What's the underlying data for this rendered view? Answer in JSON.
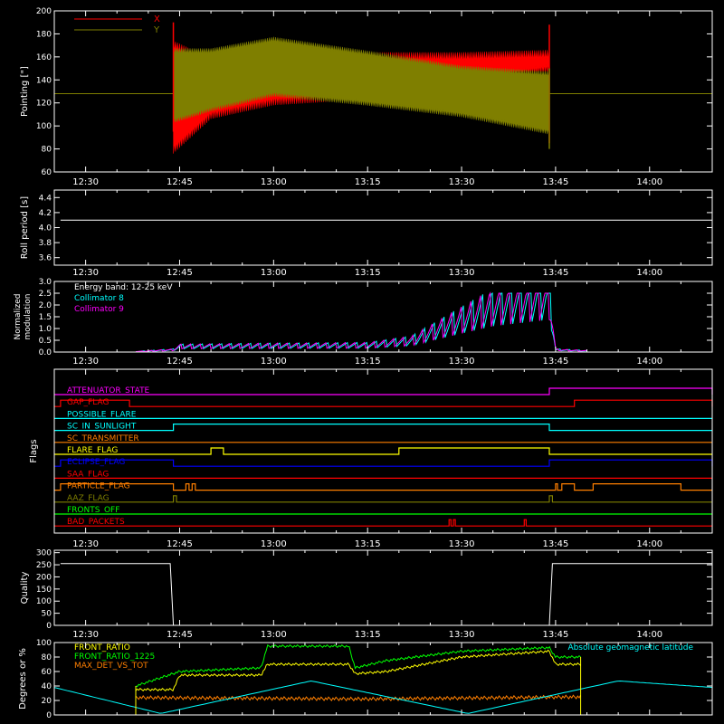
{
  "time_ticks": [
    "12:30",
    "12:45",
    "13:00",
    "13:15",
    "13:30",
    "13:45",
    "14:00"
  ],
  "time_range": [
    "12:25",
    "14:10"
  ],
  "colors": {
    "background": "#000000",
    "axes": "#ffffff",
    "red": "#ff0000",
    "olive": "#7f7f00",
    "cyan": "#00ffff",
    "magenta": "#ff00ff",
    "yellow": "#ffff00",
    "green": "#00ff00",
    "orange": "#ff7f00",
    "blue": "#0000ff",
    "white": "#ffffff"
  },
  "chart_data": [
    {
      "id": "pointing",
      "type": "line",
      "ylabel": "Pointing [\"]",
      "ylim": [
        60,
        200
      ],
      "yticks": [
        60,
        80,
        100,
        120,
        140,
        160,
        180,
        200
      ],
      "legend_position": "top-left",
      "series": [
        {
          "name": "X",
          "color": "#ff0000",
          "baseline": 128,
          "upper": [
            {
              "x": "12:44",
              "y": 170
            },
            {
              "x": "12:50",
              "y": 155
            },
            {
              "x": "13:00",
              "y": 155
            },
            {
              "x": "13:15",
              "y": 160
            },
            {
              "x": "13:30",
              "y": 160
            },
            {
              "x": "13:44",
              "y": 162
            }
          ],
          "lower": [
            {
              "x": "12:44",
              "y": 80
            },
            {
              "x": "12:50",
              "y": 110
            },
            {
              "x": "13:00",
              "y": 122
            },
            {
              "x": "13:15",
              "y": 127
            },
            {
              "x": "13:30",
              "y": 140
            },
            {
              "x": "13:44",
              "y": 150
            }
          ]
        },
        {
          "name": "Y",
          "color": "#7f7f00",
          "baseline": 128,
          "upper": [
            {
              "x": "12:44",
              "y": 165
            },
            {
              "x": "12:50",
              "y": 165
            },
            {
              "x": "13:00",
              "y": 175
            },
            {
              "x": "13:15",
              "y": 163
            },
            {
              "x": "13:30",
              "y": 150
            },
            {
              "x": "13:44",
              "y": 145
            }
          ],
          "lower": [
            {
              "x": "12:44",
              "y": 105
            },
            {
              "x": "12:50",
              "y": 115
            },
            {
              "x": "13:00",
              "y": 128
            },
            {
              "x": "13:15",
              "y": 120
            },
            {
              "x": "13:30",
              "y": 110
            },
            {
              "x": "13:44",
              "y": 95
            }
          ]
        }
      ]
    },
    {
      "id": "roll",
      "type": "line",
      "ylabel": "Roll period [s]",
      "ylim": [
        3.5,
        4.5
      ],
      "yticks": [
        3.6,
        3.8,
        4.0,
        4.2,
        4.4
      ],
      "series": [
        {
          "name": "",
          "color": "#ffffff",
          "points": [
            {
              "x": "12:26",
              "y": 4.1
            },
            {
              "x": "14:10",
              "y": 4.1
            }
          ]
        }
      ]
    },
    {
      "id": "modulation",
      "type": "line",
      "ylabel": "Normalized modulation",
      "ylabel_lines": [
        "Normalized",
        "modulation"
      ],
      "ylim": [
        0,
        3
      ],
      "yticks": [
        0.0,
        0.5,
        1.0,
        1.5,
        2.0,
        2.5,
        3.0
      ],
      "annotation": "Energy band: 12-25 keV",
      "series": [
        {
          "name": "Collimator 8",
          "color": "#00ffff"
        },
        {
          "name": "Collimator 9",
          "color": "#ff00ff"
        }
      ],
      "envelope": [
        {
          "x": "12:38",
          "y": 0.02
        },
        {
          "x": "12:44",
          "y": 0.1
        },
        {
          "x": "12:45",
          "y": 0.25
        },
        {
          "x": "13:00",
          "y": 0.28
        },
        {
          "x": "13:15",
          "y": 0.3
        },
        {
          "x": "13:22",
          "y": 0.5
        },
        {
          "x": "13:28",
          "y": 1.2
        },
        {
          "x": "13:35",
          "y": 2.0
        },
        {
          "x": "13:44",
          "y": 2.5
        },
        {
          "x": "13:45",
          "y": 0.1
        },
        {
          "x": "13:50",
          "y": 0.05
        }
      ]
    },
    {
      "id": "flags",
      "type": "line",
      "ylabel": "Flags",
      "rows": [
        {
          "label": "ATTENUATOR_STATE",
          "color": "#ff00ff",
          "highs": [
            [
              "13:44",
              "14:10"
            ]
          ]
        },
        {
          "label": "GAP_FLAG",
          "color": "#ff0000",
          "highs": [
            [
              "12:26",
              "12:37"
            ],
            [
              "13:48",
              "14:10"
            ]
          ]
        },
        {
          "label": "POSSIBLE_FLARE",
          "color": "#00ffff",
          "highs": []
        },
        {
          "label": "SC_IN_SUNLIGHT",
          "color": "#00ffff",
          "highs": [
            [
              "12:44",
              "13:44"
            ]
          ]
        },
        {
          "label": "SC_TRANSMITTER",
          "color": "#ff7f00",
          "highs": []
        },
        {
          "label": "FLARE_FLAG",
          "color": "#ffff00",
          "highs": [
            [
              "12:50",
              "12:52"
            ],
            [
              "13:20",
              "13:44"
            ]
          ]
        },
        {
          "label": "ECLIPSE_FLAG",
          "color": "#0000ff",
          "highs": [
            [
              "12:26",
              "12:44"
            ],
            [
              "13:44",
              "14:10"
            ]
          ]
        },
        {
          "label": "SAA_FLAG",
          "color": "#ff0000",
          "highs": []
        },
        {
          "label": "PARTICLE_FLAG",
          "color": "#ff7f00",
          "highs": [
            [
              "12:26",
              "12:44"
            ],
            [
              "12:46",
              "12:46.5"
            ],
            [
              "12:47",
              "12:47.5"
            ],
            [
              "13:45",
              "13:45.3"
            ],
            [
              "13:46",
              "13:48"
            ],
            [
              "13:51",
              "14:05"
            ]
          ]
        },
        {
          "label": "AAZ_FLAG",
          "color": "#7f7f00",
          "highs": [
            [
              "12:44",
              "12:44.5"
            ],
            [
              "13:44",
              "13:44.5"
            ]
          ]
        },
        {
          "label": "FRONTS_OFF",
          "color": "#00ff00",
          "highs": []
        },
        {
          "label": "BAD_PACKETS",
          "color": "#ff0000",
          "highs": [
            [
              "13:28",
              "13:28.3"
            ],
            [
              "13:28.7",
              "13:29"
            ],
            [
              "13:40",
              "13:40.3"
            ]
          ]
        }
      ]
    },
    {
      "id": "quality",
      "type": "line",
      "ylabel": "Quality",
      "ylim": [
        0,
        310
      ],
      "yticks": [
        0,
        50,
        100,
        150,
        200,
        250,
        300
      ],
      "series": [
        {
          "name": "",
          "color": "#ffffff",
          "points": [
            {
              "x": "12:26",
              "y": 255
            },
            {
              "x": "12:43.5",
              "y": 255
            },
            {
              "x": "12:44",
              "y": 0
            },
            {
              "x": "13:44",
              "y": 0
            },
            {
              "x": "13:44.5",
              "y": 255
            },
            {
              "x": "14:10",
              "y": 255
            }
          ]
        }
      ]
    },
    {
      "id": "ratios",
      "type": "line",
      "ylabel": "Degrees or %",
      "ylim": [
        0,
        100
      ],
      "yticks": [
        0,
        20,
        40,
        60,
        80,
        100
      ],
      "series": [
        {
          "name": "FRONT_RATIO",
          "color": "#ffff00",
          "points": [
            {
              "x": "12:38",
              "y": 35
            },
            {
              "x": "12:44",
              "y": 35
            },
            {
              "x": "12:45",
              "y": 55
            },
            {
              "x": "12:58",
              "y": 55
            },
            {
              "x": "12:59",
              "y": 70
            },
            {
              "x": "13:12",
              "y": 70
            },
            {
              "x": "13:13",
              "y": 57
            },
            {
              "x": "13:18",
              "y": 60
            },
            {
              "x": "13:30",
              "y": 80
            },
            {
              "x": "13:44",
              "y": 88
            },
            {
              "x": "13:45",
              "y": 70
            },
            {
              "x": "13:49",
              "y": 70
            }
          ]
        },
        {
          "name": "FRONT_RATIO_1225",
          "color": "#00ff00",
          "points": [
            {
              "x": "12:38",
              "y": 40
            },
            {
              "x": "12:45",
              "y": 60
            },
            {
              "x": "12:58",
              "y": 65
            },
            {
              "x": "12:59",
              "y": 95
            },
            {
              "x": "13:12",
              "y": 95
            },
            {
              "x": "13:13",
              "y": 65
            },
            {
              "x": "13:18",
              "y": 75
            },
            {
              "x": "13:30",
              "y": 88
            },
            {
              "x": "13:44",
              "y": 93
            },
            {
              "x": "13:45",
              "y": 80
            },
            {
              "x": "13:49",
              "y": 80
            }
          ]
        },
        {
          "name": "MAX_DET_VS_TOT",
          "color": "#ff7f00",
          "points": [
            {
              "x": "12:38",
              "y": 24
            },
            {
              "x": "13:15",
              "y": 22
            },
            {
              "x": "13:49",
              "y": 25
            }
          ]
        },
        {
          "name": "Absolute geomagnetic latitude",
          "color": "#00ffff",
          "points": [
            {
              "x": "12:25",
              "y": 38
            },
            {
              "x": "12:42",
              "y": 2
            },
            {
              "x": "13:06",
              "y": 47
            },
            {
              "x": "13:31",
              "y": 2
            },
            {
              "x": "13:55",
              "y": 47
            },
            {
              "x": "14:10",
              "y": 38
            }
          ]
        }
      ]
    }
  ]
}
